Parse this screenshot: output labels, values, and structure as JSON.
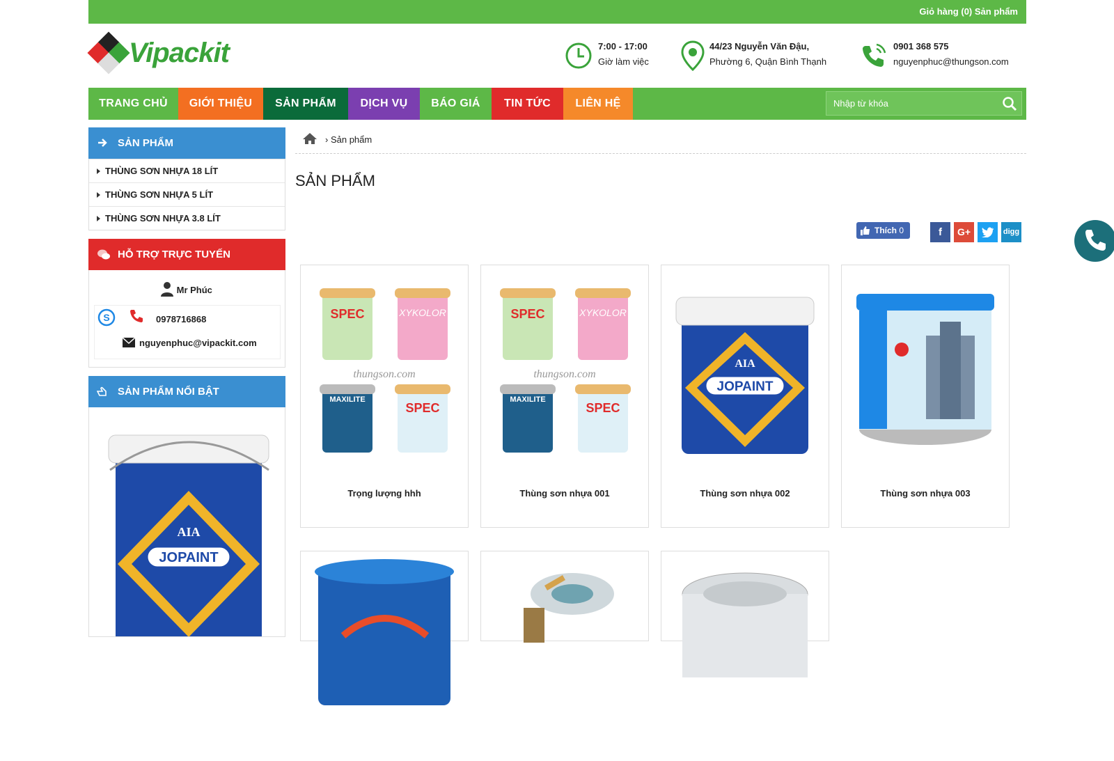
{
  "topbar": {
    "cart": "Giỏ hàng (0) Sản phẩm"
  },
  "logo": {
    "brand": "Vipackit"
  },
  "header": {
    "hours": {
      "line1": "7:00 - 17:00",
      "line2": "Giờ làm việc"
    },
    "address": {
      "line1": "44/23 Nguyễn Văn Đậu,",
      "line2": "Phường 6, Quận Bình Thạnh"
    },
    "contact": {
      "line1": "0901 368 575",
      "line2": "nguyenphuc@thungson.com"
    }
  },
  "nav": {
    "items": [
      {
        "label": "TRANG CHỦ",
        "color": "#5db847"
      },
      {
        "label": "GIỚI THIỆU",
        "color": "#f36f21"
      },
      {
        "label": "SẢN PHẨM",
        "color": "#0b6b3a"
      },
      {
        "label": "DỊCH VỤ",
        "color": "#7b3fb0"
      },
      {
        "label": "BÁO GIÁ",
        "color": "#5db847"
      },
      {
        "label": "TIN TỨC",
        "color": "#e02b2b"
      },
      {
        "label": "LIÊN HỆ",
        "color": "#f5892a"
      }
    ],
    "search_placeholder": "Nhập từ khóa"
  },
  "sidebar": {
    "products_title": "SẢN PHẨM",
    "categories": [
      "THÙNG SƠN NHỰA 18 LÍT",
      "THÙNG SƠN NHỰA 5 LÍT",
      "THÙNG SƠN NHỰA 3.8 LÍT"
    ],
    "support_title": "HỖ TRỢ TRỰC TUYẾN",
    "support_name": "Mr Phúc",
    "support_phone": "0978716868",
    "support_email": "nguyenphuc@vipackit.com",
    "featured_title": "SẢN PHẨM NỔI BẬT",
    "colors": {
      "blue": "#3a8fd1",
      "red": "#e02b2b"
    }
  },
  "breadcrumb": {
    "current": "Sản phẩm"
  },
  "page_title": "SẢN PHẨM",
  "social": {
    "like_label": "Thích",
    "like_count": "0"
  },
  "products": [
    {
      "name": "Trọng lượng hhh"
    },
    {
      "name": "Thùng sơn nhựa 001"
    },
    {
      "name": "Thùng sơn nhựa 002"
    },
    {
      "name": "Thùng sơn nhựa 003"
    },
    {
      "name": ""
    },
    {
      "name": ""
    },
    {
      "name": ""
    }
  ]
}
